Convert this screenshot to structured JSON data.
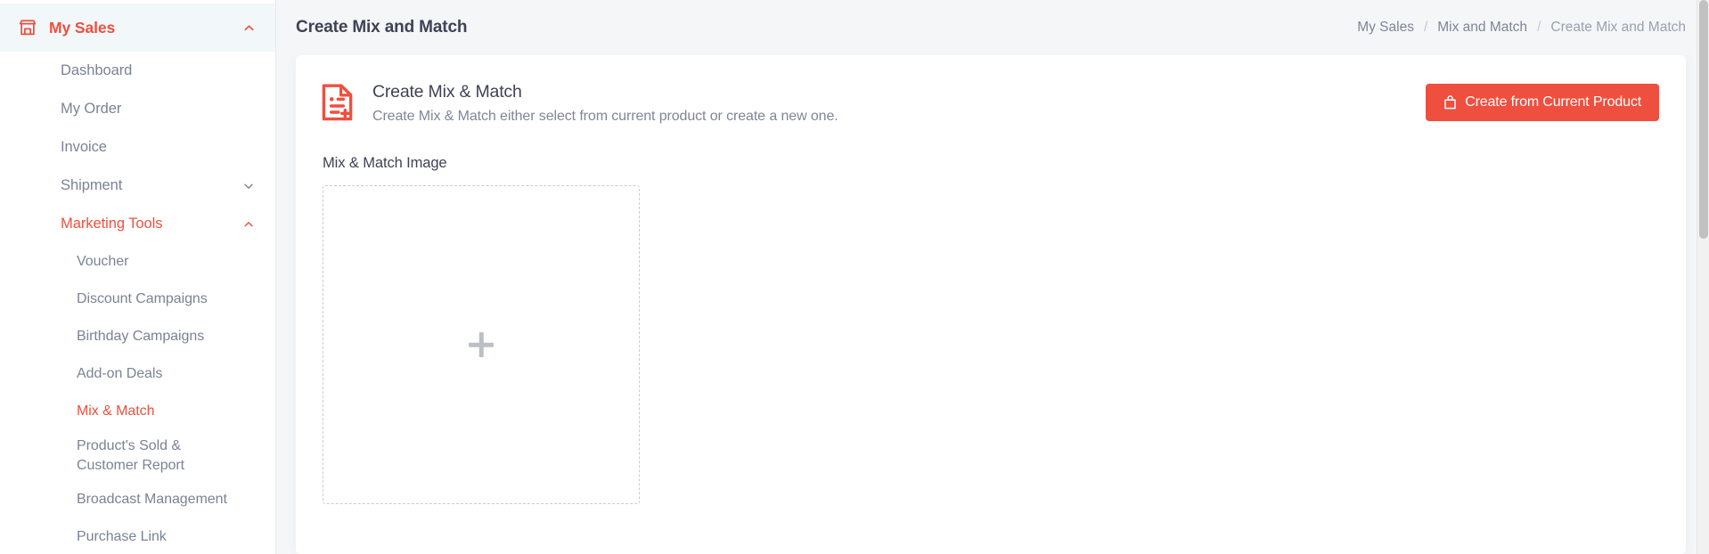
{
  "sidebar": {
    "root": {
      "label": "My Sales",
      "icon": "store-icon",
      "chevron": "chevron-up-icon",
      "expanded": true,
      "accent_color": "#ef4f3f",
      "active_bg": "#f2f7f9"
    },
    "items": [
      {
        "label": "Dashboard",
        "type": "item",
        "active": false
      },
      {
        "label": "My Order",
        "type": "item",
        "active": false
      },
      {
        "label": "Invoice",
        "type": "item",
        "active": false
      },
      {
        "label": "Shipment",
        "type": "group",
        "active": false,
        "chevron": "chevron-down-icon",
        "expanded": false
      },
      {
        "label": "Marketing Tools",
        "type": "group",
        "active": true,
        "chevron": "chevron-up-icon",
        "expanded": true
      }
    ],
    "sub_items": [
      {
        "label": "Voucher",
        "active": false
      },
      {
        "label": "Discount Campaigns",
        "active": false
      },
      {
        "label": "Birthday Campaigns",
        "active": false
      },
      {
        "label": "Add-on Deals",
        "active": false
      },
      {
        "label": "Mix & Match",
        "active": true
      },
      {
        "label": "Product's Sold & Customer Report",
        "active": false,
        "twoline": true
      },
      {
        "label": "Broadcast Management",
        "active": false
      },
      {
        "label": "Purchase Link",
        "active": false
      }
    ]
  },
  "header": {
    "title": "Create Mix and Match",
    "breadcrumb": [
      {
        "label": "My Sales",
        "current": false
      },
      {
        "label": "Mix and Match",
        "current": false
      },
      {
        "label": "Create Mix and Match",
        "current": true
      }
    ],
    "separator": "/"
  },
  "card": {
    "icon": "document-plus-icon",
    "title": "Create Mix & Match",
    "subtitle": "Create Mix & Match either select from current product or create a new one.",
    "action_button": {
      "label": "Create from Current Product",
      "icon": "shopping-bag-icon",
      "color": "#ef4f3f"
    }
  },
  "form": {
    "image_field_label": "Mix & Match Image",
    "dropzone": {
      "icon": "plus-icon",
      "border_style": "dashed",
      "border_color": "#c9ccd2"
    }
  },
  "scrollbar": {
    "orientation": "vertical"
  }
}
